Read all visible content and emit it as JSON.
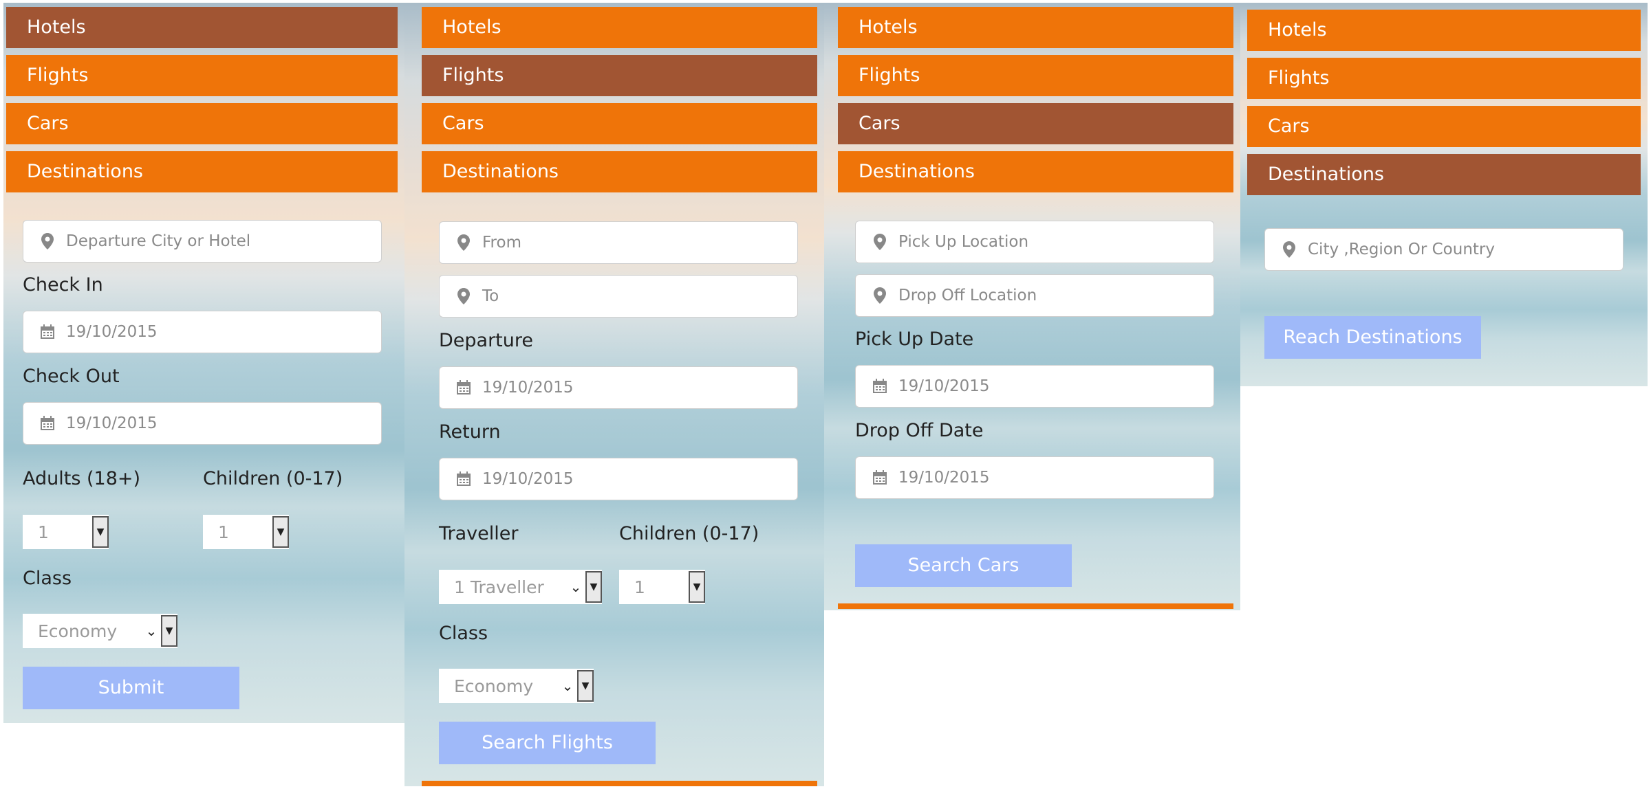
{
  "tabs": {
    "hotels": "Hotels",
    "flights": "Flights",
    "cars": "Cars",
    "destinations": "Destinations"
  },
  "hotels_form": {
    "departure_placeholder": "Departure City or Hotel",
    "check_in_label": "Check In",
    "check_in_value": "19/10/2015",
    "check_out_label": "Check Out",
    "check_out_value": "19/10/2015",
    "adults_label": "Adults (18+)",
    "adults_value": "1",
    "children_label": "Children (0-17)",
    "children_value": "1",
    "class_label": "Class",
    "class_value": "Economy",
    "submit_label": "Submit"
  },
  "flights_form": {
    "from_placeholder": "From",
    "to_placeholder": "To",
    "departure_label": "Departure",
    "departure_value": "19/10/2015",
    "return_label": "Return",
    "return_value": "19/10/2015",
    "traveller_label": "Traveller",
    "traveller_value": "1 Traveller",
    "children_label": "Children (0-17)",
    "children_value": "1",
    "class_label": "Class",
    "class_value": "Economy",
    "search_label": "Search Flights"
  },
  "cars_form": {
    "pickup_location_placeholder": "Pick Up Location",
    "dropoff_location_placeholder": "Drop Off Location",
    "pickup_date_label": "Pick Up Date",
    "pickup_date_value": "19/10/2015",
    "dropoff_date_label": "Drop Off Date",
    "dropoff_date_value": "19/10/2015",
    "search_label": "Search Cars"
  },
  "destinations_form": {
    "location_placeholder": "City ,Region Or Country",
    "search_label": "Reach Destinations"
  },
  "colors": {
    "tab": "#ef7409",
    "tab_active": "#a15533",
    "button": "#9fb9f9"
  },
  "icons": {
    "location": "map-pin-icon",
    "date": "calendar-icon"
  }
}
